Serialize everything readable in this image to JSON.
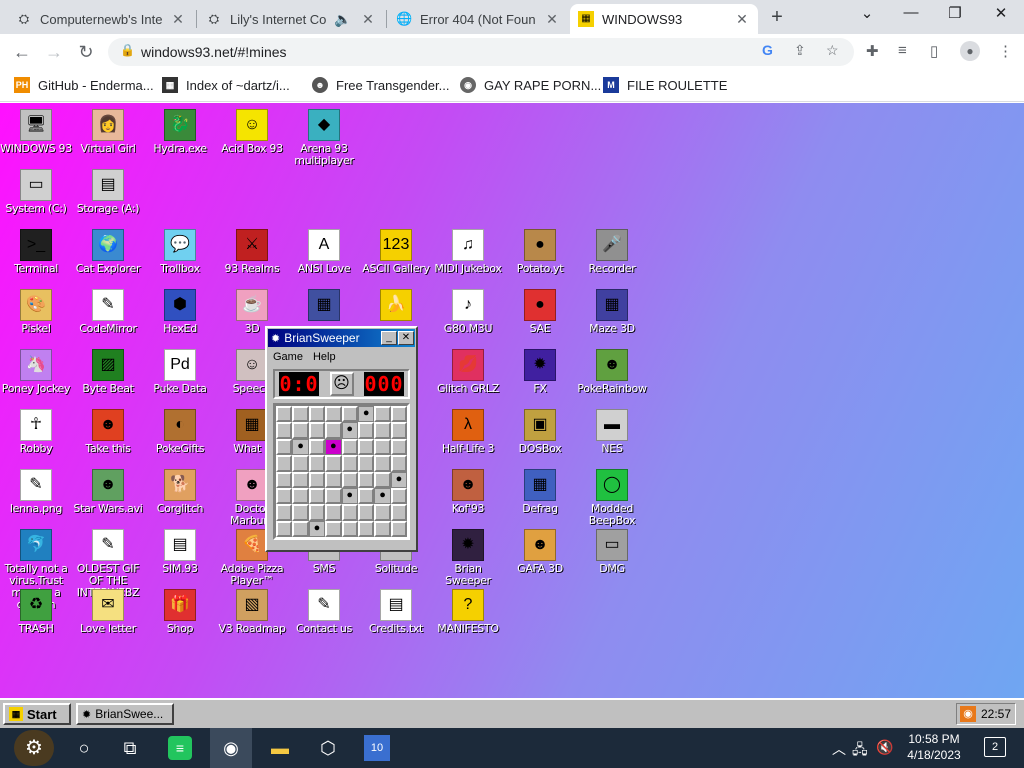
{
  "browser": {
    "tabs": [
      {
        "title": "Computernewb's Inte",
        "icon": "fanbox-icon"
      },
      {
        "title": "Lily's Internet Co",
        "icon": "fanbox-icon"
      },
      {
        "title": "Error 404 (Not Foun",
        "icon": "globe-icon"
      },
      {
        "title": "WINDOWS93",
        "icon": "windows93-icon"
      }
    ],
    "new_tab": "+",
    "minimize": "⌄",
    "url": "windows93.net/#!mines"
  },
  "bookmarks": [
    {
      "label": "GitHub - Enderma...",
      "icon_text": "PH",
      "color": "#f08c00"
    },
    {
      "label": "Index of ~dartz/i...",
      "icon_text": "▦",
      "color": "#333333"
    },
    {
      "label": "Free Transgender...",
      "icon_text": "☻",
      "color": "#555555"
    },
    {
      "label": "GAY RAPE PORN...",
      "icon_text": "◉",
      "color": "#666666"
    },
    {
      "label": "FILE ROULETTE",
      "icon_text": "M",
      "color": "#1a3a9a"
    }
  ],
  "desktop_icons": [
    {
      "label": "WINDOWS 93",
      "glyph": "🖥",
      "bg": "#c0c0c0"
    },
    {
      "label": "Virtual Girl",
      "glyph": "👩",
      "bg": "#e8b89a"
    },
    {
      "label": "Hydra.exe",
      "glyph": "🐉",
      "bg": "#3a8a3a"
    },
    {
      "label": "Acid Box 93",
      "glyph": "☺",
      "bg": "#f5e400"
    },
    {
      "label": "Arena 93 multiplayer",
      "glyph": "◆",
      "bg": "#3ab0c0"
    },
    {
      "label": "System (C:)",
      "glyph": "▭",
      "bg": "#d0d0d0"
    },
    {
      "label": "Storage (A:)",
      "glyph": "▤",
      "bg": "#d0d0d0"
    },
    {
      "label": "Terminal",
      "glyph": ">_",
      "bg": "#202020"
    },
    {
      "label": "Cat Explorer",
      "glyph": "🌍",
      "bg": "#3a8ad0"
    },
    {
      "label": "Trollbox",
      "glyph": "💬",
      "bg": "#70d0f0"
    },
    {
      "label": "93 Realms",
      "glyph": "⚔",
      "bg": "#c02020"
    },
    {
      "label": "ANSI Love",
      "glyph": "A",
      "bg": "#ffffff"
    },
    {
      "label": "ASCII Gallery",
      "glyph": "123",
      "bg": "#f5d000"
    },
    {
      "label": "MIDI Jukebox",
      "glyph": "♫",
      "bg": "#ffffff"
    },
    {
      "label": "Potato.yt",
      "glyph": "●",
      "bg": "#b8884a"
    },
    {
      "label": "Recorder",
      "glyph": "🎤",
      "bg": "#909090"
    },
    {
      "label": "Piskel",
      "glyph": "🎨",
      "bg": "#e8c060"
    },
    {
      "label": "CodeMirror",
      "glyph": "✎",
      "bg": "#ffffff"
    },
    {
      "label": "HexEd",
      "glyph": "⬢",
      "bg": "#3050c0"
    },
    {
      "label": "3D",
      "glyph": "☕",
      "bg": "#f0a0c0"
    },
    {
      "label": "",
      "glyph": "▦",
      "bg": "#4050a0"
    },
    {
      "label": "",
      "glyph": "🍌",
      "bg": "#f5d000"
    },
    {
      "label": "G80.M3U",
      "glyph": "♪",
      "bg": "#ffffff"
    },
    {
      "label": "SAE",
      "glyph": "●",
      "bg": "#e03030"
    },
    {
      "label": "Maze 3D",
      "glyph": "▦",
      "bg": "#4040a0"
    },
    {
      "label": "Poney Jockey",
      "glyph": "🦄",
      "bg": "#c080f0"
    },
    {
      "label": "Byte Beat",
      "glyph": "▨",
      "bg": "#208020"
    },
    {
      "label": "Puke Data",
      "glyph": "Pd",
      "bg": "#ffffff"
    },
    {
      "label": "Speech",
      "glyph": "☺",
      "bg": "#d0c0c0"
    },
    {
      "label": "Glitch GRLZ",
      "glyph": "💋",
      "bg": "#e03060"
    },
    {
      "label": "FX",
      "glyph": "✹",
      "bg": "#4020a0"
    },
    {
      "label": "PokeRainbow",
      "glyph": "☻",
      "bg": "#60a040"
    },
    {
      "label": "Robby",
      "glyph": "☥",
      "bg": "#ffffff"
    },
    {
      "label": "Take this",
      "glyph": "☻",
      "bg": "#e04020"
    },
    {
      "label": "PokeGifts",
      "glyph": "◐",
      "bg": "#b07030"
    },
    {
      "label": "What If",
      "glyph": "▦",
      "bg": "#a06020"
    },
    {
      "label": "Half-Life 3",
      "glyph": "λ",
      "bg": "#e06010"
    },
    {
      "label": "DOSBox",
      "glyph": "▣",
      "bg": "#c0a040"
    },
    {
      "label": "NES",
      "glyph": "▬",
      "bg": "#d0d0d0"
    },
    {
      "label": "lenna.png",
      "glyph": "✎",
      "bg": "#ffffff"
    },
    {
      "label": "Star Wars.avi",
      "glyph": "☻",
      "bg": "#60a060"
    },
    {
      "label": "Corglitch",
      "glyph": "🐕",
      "bg": "#e0a060"
    },
    {
      "label": "Doctor Marburg",
      "glyph": "☻",
      "bg": "#f0a0c0"
    },
    {
      "label": "Kof'93",
      "glyph": "☻",
      "bg": "#c06040"
    },
    {
      "label": "Defrag",
      "glyph": "▦",
      "bg": "#4060c0"
    },
    {
      "label": "Modded BeepBox",
      "glyph": "◯",
      "bg": "#20c040"
    },
    {
      "label": "Totally not a virus.Trust me...im a dolphin",
      "glyph": "🐬",
      "bg": "#2080c0"
    },
    {
      "label": "OLDEST GIF OF THE INTERWEBZ",
      "glyph": "✎",
      "bg": "#ffffff"
    },
    {
      "label": "SIM.93",
      "glyph": "▤",
      "bg": "#ffffff"
    },
    {
      "label": "Adobe Pizza Player™",
      "glyph": "🍕",
      "bg": "#e08040"
    },
    {
      "label": "SMS",
      "glyph": "",
      "bg": "#c0c0c0"
    },
    {
      "label": "Solitude",
      "glyph": "",
      "bg": "#c0c0c0"
    },
    {
      "label": "Brian Sweeper",
      "glyph": "✹",
      "bg": "#302040"
    },
    {
      "label": "GAFA 3D",
      "glyph": "☻",
      "bg": "#e0a040"
    },
    {
      "label": "DMG",
      "glyph": "▭",
      "bg": "#a0a0a0"
    },
    {
      "label": "TRASH",
      "glyph": "♻",
      "bg": "#40a040"
    },
    {
      "label": "Love letter",
      "glyph": "✉",
      "bg": "#f5e080"
    },
    {
      "label": "Shop",
      "glyph": "🎁",
      "bg": "#e03030"
    },
    {
      "label": "V3 Roadmap",
      "glyph": "▧",
      "bg": "#d0a060"
    },
    {
      "label": "Contact us",
      "glyph": "✎",
      "bg": "#ffffff"
    },
    {
      "label": "Credits.txt",
      "glyph": "▤",
      "bg": "#ffffff"
    },
    {
      "label": "MANIFESTO",
      "glyph": "?",
      "bg": "#f5d000"
    }
  ],
  "briansweeper": {
    "title": "BrianSweeper",
    "menu": [
      "Game",
      "Help"
    ],
    "mines_left": "0:0",
    "timer": "000",
    "face": "☹",
    "cells": [
      "",
      "",
      "",
      "",
      "",
      "*",
      "",
      "",
      "",
      "",
      "",
      "",
      "*",
      "",
      "",
      "",
      "",
      "*",
      "",
      "X",
      "",
      "",
      "",
      "",
      "",
      "",
      "",
      "",
      "",
      "",
      "",
      "",
      "",
      "",
      "",
      "",
      "",
      "",
      "",
      "*",
      "",
      "",
      "",
      "",
      "*",
      "",
      "*",
      "",
      "",
      "",
      "",
      "",
      "",
      "",
      "",
      "",
      "",
      "",
      "*",
      "",
      "",
      "",
      "",
      ""
    ]
  },
  "w93_taskbar": {
    "start": "Start",
    "task": "BrianSwee...",
    "clock": "22:57"
  },
  "win_taskbar": {
    "time": "10:58 PM",
    "date": "4/18/2023",
    "notifications": "2"
  }
}
